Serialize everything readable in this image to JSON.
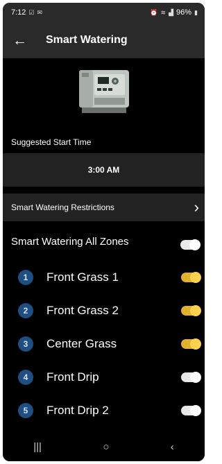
{
  "status_bar": {
    "time": "7:12",
    "left_icons": [
      "alarm-check-icon",
      "mail-icon"
    ],
    "battery": "96%",
    "right_icons": [
      "alarm-icon",
      "wifi-icon",
      "signal-icon",
      "battery-icon"
    ]
  },
  "header": {
    "title": "Smart Watering",
    "back_icon": "arrow-left-icon"
  },
  "device": {
    "image": "controller-device-image"
  },
  "start_time": {
    "label": "Suggested Start Time",
    "value": "3:00 AM"
  },
  "restrictions": {
    "label": "Smart Watering Restrictions"
  },
  "all_zones": {
    "label": "Smart Watering All Zones",
    "enabled": false
  },
  "zones": [
    {
      "number": "1",
      "name": "Front Grass 1",
      "enabled": true
    },
    {
      "number": "2",
      "name": "Front Grass 2",
      "enabled": true
    },
    {
      "number": "3",
      "name": "Center Grass",
      "enabled": true
    },
    {
      "number": "4",
      "name": "Front Drip",
      "enabled": false
    },
    {
      "number": "5",
      "name": "Front Drip 2",
      "enabled": false
    }
  ],
  "nav": {
    "recent": "|||",
    "home": "○",
    "back": "‹"
  },
  "colors": {
    "accent_on": "#ffd24d",
    "zone_badge": "#1f4f80",
    "row_bg": "#222222",
    "header_bg": "#2a2a2a"
  }
}
